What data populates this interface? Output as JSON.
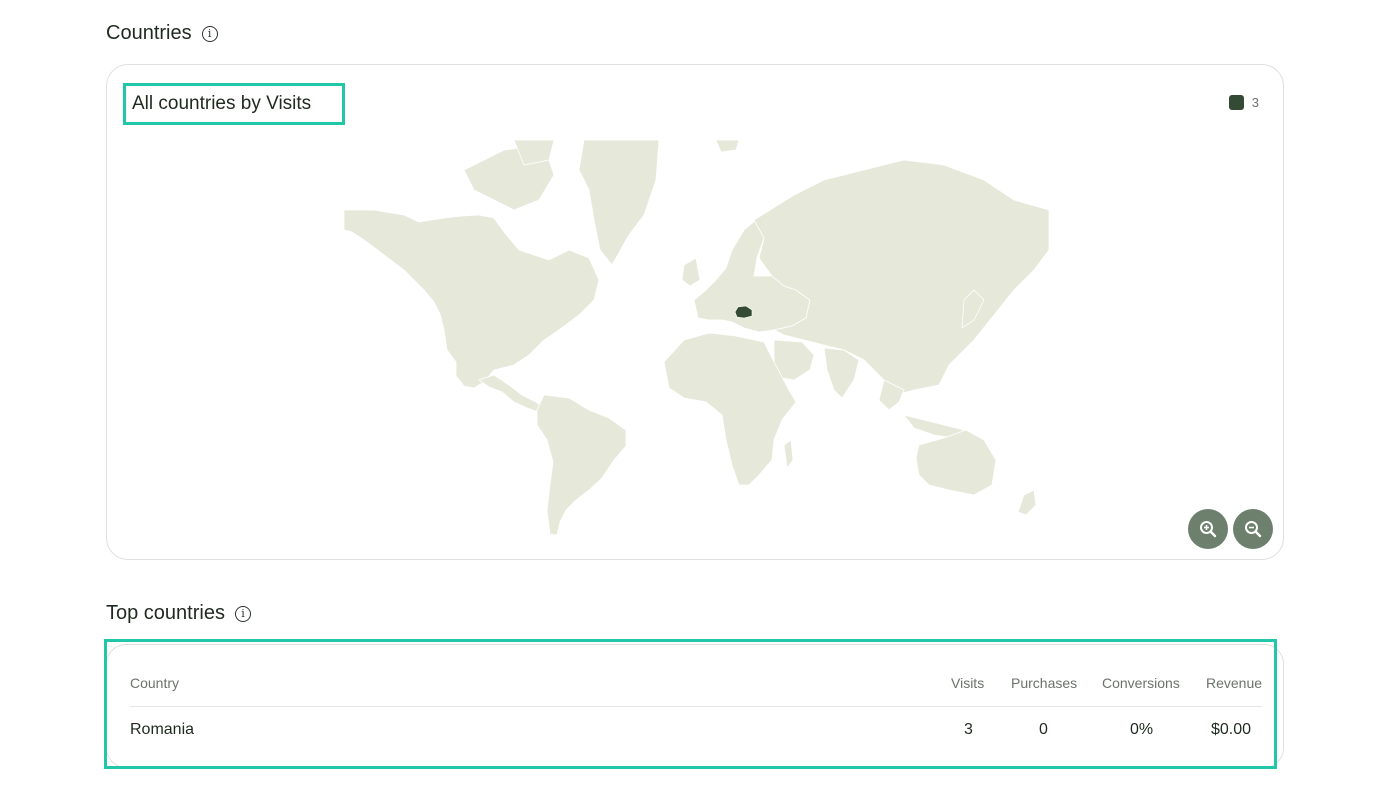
{
  "countries_section": {
    "title": "Countries",
    "info_icon": "info-icon"
  },
  "map_card": {
    "title": "All countries by Visits",
    "legend": {
      "value": "3",
      "color": "#354a35"
    },
    "highlighted_country": "Romania",
    "land_color": "#e6e9d9",
    "zoom_in_icon": "zoom-in-icon",
    "zoom_out_icon": "zoom-out-icon"
  },
  "top_countries": {
    "title": "Top countries",
    "info_icon": "info-icon",
    "columns": {
      "country": "Country",
      "visits": "Visits",
      "purchases": "Purchases",
      "conversions": "Conversions",
      "revenue": "Revenue"
    },
    "rows": [
      {
        "country": "Romania",
        "visits": "3",
        "purchases": "0",
        "conversions": "0%",
        "revenue": "$0.00"
      }
    ]
  },
  "colors": {
    "accent_highlight": "#22c7a9",
    "zoom_button": "#6d806d"
  }
}
